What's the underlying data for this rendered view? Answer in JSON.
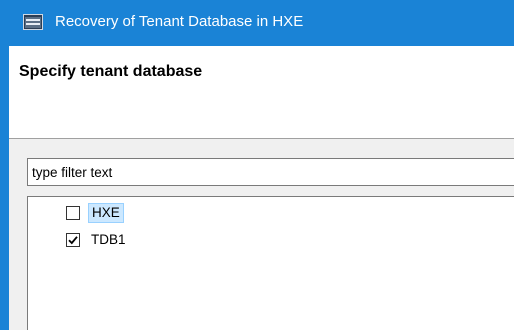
{
  "window": {
    "title": "Recovery of Tenant Database in HXE",
    "app_icon": "database-window-icon",
    "accent_color": "#1a83d6"
  },
  "header": {
    "title": "Specify tenant database"
  },
  "filter": {
    "placeholder": "type filter text"
  },
  "tree": {
    "items": [
      {
        "label": "HXE",
        "checked": false,
        "selected": true
      },
      {
        "label": "TDB1",
        "checked": true,
        "selected": false
      }
    ]
  }
}
